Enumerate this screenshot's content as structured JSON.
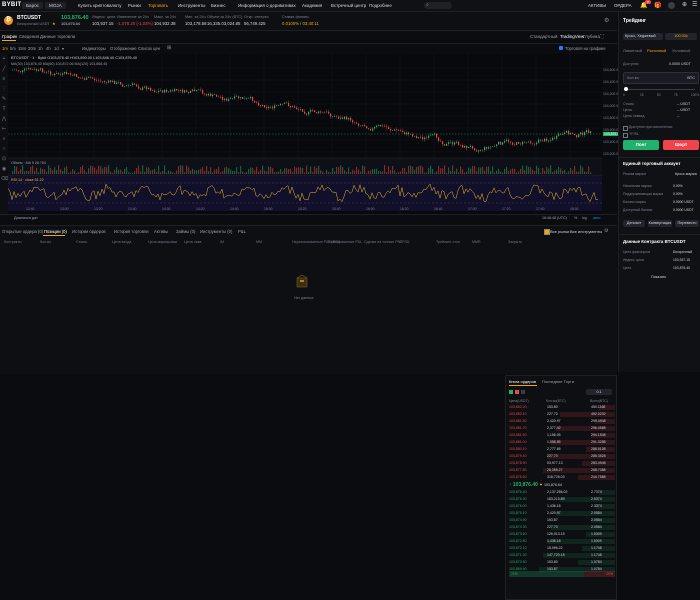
{
  "nav": {
    "logo": "BYBIT",
    "pills": [
      "Барос",
      "MOJA"
    ],
    "items": [
      "Купить криптовалюту",
      "Рынки",
      "Торговать",
      "Инструменты",
      "Бизнес",
      "Информация о деривативах",
      "Академия",
      "Встречный центр",
      "Подробнее"
    ],
    "active_index": 2,
    "right_items": [
      "АКТИВЫ",
      "ОРДЕРА"
    ],
    "notif_count": "8"
  },
  "ticker": {
    "symbol": "BTCUSDT",
    "subtitle": "Бессрочный USDT",
    "last_price": "103,876.40",
    "mark_price": "103,876.64",
    "stats": [
      {
        "label": "Индекс. цена",
        "value": "103,937.15"
      },
      {
        "label": "Изменение за 24ч",
        "value": "-1,078.20 (-1.03%)",
        "color": "red"
      },
      {
        "label": "Макс. за 24ч",
        "value": "104,932.38"
      },
      {
        "label": "Мин. за 24ч",
        "value": "103,178.58"
      },
      {
        "label": "Объем за 24ч (BTC)",
        "value": "16,335.03,024.85"
      },
      {
        "label": "Откр. интерес",
        "value": "56,749.425"
      },
      {
        "label": "Ставка финанс.",
        "value": "0.0100% / 03:40:11",
        "color": "orange"
      }
    ]
  },
  "chart_tabs": [
    "График",
    "Сведения",
    "Данные торговли"
  ],
  "chart_right_tabs": [
    "Стандартный",
    "TradingView",
    "Глубина"
  ],
  "toolbar": [
    "1m",
    "5m",
    "15m",
    "30m",
    "1h",
    "4h",
    "1d",
    "Индикаторы",
    "Отображение",
    "Список цен"
  ],
  "toolbar_right": "Торговля на графике",
  "chart_legend": "BTCUSDT · 1 · Bybit  O103,876.40  H103,890.00  L103,846.40  C103,876.40",
  "ma_legend": "MA(30) 103,876.40  MA(60) 103,872.06  MA(120) 103,868.45",
  "vol_legend": "Объем · MA 9  28.784",
  "rsi_legend": "RSI 14 · close  51.22",
  "price_ticks": [
    "104,600.00",
    "104,400.00",
    "104,200.00",
    "104,000.00",
    "103,800.00",
    "103,600.00",
    "103,400.00",
    "103,200.00"
  ],
  "price_tag": "103,876.40",
  "time_ticks": [
    "12:40",
    "13:00",
    "13:20",
    "13:40",
    "14:00",
    "14:20",
    "14:40",
    "15:00",
    "15:20",
    "15:40",
    "16:00",
    "16:20",
    "16:40",
    "17:00",
    "17:20",
    "17:40",
    "18:00"
  ],
  "chart_footer_left": "Диапазон дат",
  "chart_footer_right": "18:46:48 (UTC)",
  "chart_footer_opts": [
    "%",
    "log",
    "авто"
  ],
  "positions": {
    "tabs": [
      "Открытые ордера (0)",
      "Позиции (0)",
      "История ордеров",
      "История торговли",
      "Активы",
      "Займы (0)",
      "Инструменты (0)",
      "P&L"
    ],
    "active_index": 1,
    "right_toggles": [
      "Все рынки",
      "Все инструменты"
    ],
    "columns": [
      "Контракты",
      "Кол-во",
      "Стоим.",
      "Цена входа",
      "Цена маркировки",
      "Цена ликв.",
      "IM",
      "MM",
      "Нереализованные P&L (ROI)",
      "Реализованные P&L",
      "Сделки на точные PNL",
      "TP/SL",
      "Трейлинг-стоп",
      "MMR",
      "Закрыть"
    ],
    "empty": "Нет данных"
  },
  "trade_panel": {
    "title": "Трейдинг",
    "mode": "Кросс, Хеджевый",
    "leverage": "100.00x",
    "order_types": [
      "Лимитный",
      "Рыночный",
      "Условный"
    ],
    "active_type": 1,
    "available_label": "Доступно",
    "available_value": "0.0000 USDT",
    "qty_label": "Кол-во",
    "qty_unit": "BTC",
    "slider_marks": [
      "0",
      "25",
      "50",
      "75",
      "100%"
    ],
    "cost_rows": [
      {
        "label": "Стоим.",
        "value": "-- USDT"
      },
      {
        "label": "Цена",
        "value": "-- USDT"
      },
      {
        "label": "Цена ликвид.",
        "value": "--"
      }
    ],
    "checkboxes": [
      "Доступно при исполнении",
      "TP/SL"
    ],
    "buy_label": "Лонг",
    "sell_label": "Шорт",
    "uta_title": "Единый торговый аккаунт",
    "uta_mode_label": "Режим маржи",
    "uta_mode_value": "Кросс-маржа",
    "uta_rows": [
      {
        "label": "Начальная маржа",
        "value": "0.00%"
      },
      {
        "label": "Поддерживающая маржа",
        "value": "0.00%"
      },
      {
        "label": "Баланс маржи",
        "value": "0.0000 USDT"
      },
      {
        "label": "Доступный баланс",
        "value": "0.0000 USDT"
      }
    ],
    "uta_buttons": [
      "Депозит",
      "Конвертация",
      "Перевести"
    ],
    "contract_title": "Данные Контракта BTCUSDT",
    "contract_rows": [
      {
        "label": "Цена фьючерсов",
        "value": "Бессрочный"
      },
      {
        "label": "Индекс. цена",
        "value": "103,937.15"
      },
      {
        "label": "Цена",
        "value": "103,876.40"
      }
    ],
    "more": "Показать"
  },
  "orderbook": {
    "tabs": [
      "Книга ордеров",
      "Последние Торги"
    ],
    "step": "0.1",
    "headers": [
      "Цена(USDT)",
      "Кол-во(BTC)",
      "Всего(BTC)"
    ],
    "asks": [
      {
        "price": "103,882.20",
        "qty": "153.80",
        "total": "450.1168"
      },
      {
        "price": "103,882.10",
        "qty": "227.70",
        "total": "452.0232"
      },
      {
        "price": "103,881.80",
        "qty": "2,420.97",
        "total": "299.4948"
      },
      {
        "price": "103,881.70",
        "qty": "2,377.42",
        "total": "296.4588"
      },
      {
        "price": "103,881.50",
        "qty": "1,156.05",
        "total": "294.1548"
      },
      {
        "price": "103,881.00",
        "qty": "1,558.85",
        "total": "291.3288"
      },
      {
        "price": "103,880.10",
        "qty": "2,777.65",
        "total": "288.5108"
      },
      {
        "price": "103,879.40",
        "qty": "227.70",
        "total": "285.3528"
      },
      {
        "price": "103,878.90",
        "qty": "53,977.13",
        "total": "283.4948"
      },
      {
        "price": "103,877.80",
        "qty": "26,355.27",
        "total": "268.7388"
      },
      {
        "price": "103,876.50",
        "qty": "318,726.03",
        "total": "244.7588"
      }
    ],
    "mid_price": "103,876.40",
    "mid_mark": "103,876.64",
    "bids": [
      {
        "price": "103,876.40",
        "qty": "2,137,256.02",
        "total": "2.7374"
      },
      {
        "price": "103,876.30",
        "qty": "183,215.89",
        "total": "2.5374"
      },
      {
        "price": "103,876.00",
        "qty": "1,436.18",
        "total": "2.3374"
      },
      {
        "price": "103,875.10",
        "qty": "2,420.97",
        "total": "2.0584"
      },
      {
        "price": "103,874.90",
        "qty": "153.87",
        "total": "2.0584"
      },
      {
        "price": "103,874.30",
        "qty": "227.70",
        "total": "2.0584"
      },
      {
        "price": "103,873.60",
        "qty": "126,913.15",
        "total": "1.5309"
      },
      {
        "price": "103,872.80",
        "qty": "1,436.18",
        "total": "1.5309"
      },
      {
        "price": "103,872.10",
        "qty": "15,996.22",
        "total": "1.1748"
      },
      {
        "price": "103,871.30",
        "qty": "147,720.18",
        "total": "1.1748"
      },
      {
        "price": "103,870.50",
        "qty": "153.80",
        "total": "1.0784"
      },
      {
        "price": "103,869.90",
        "qty": "153.87",
        "total": "1.0784"
      }
    ],
    "ratio_buy": "71%",
    "ratio_sell": "29%"
  },
  "colors": {
    "green": "#20b26c",
    "red": "#ef454a",
    "accent": "#f7a600",
    "rsi": "#e6c229"
  }
}
